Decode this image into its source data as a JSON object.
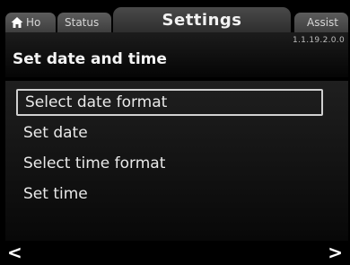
{
  "tabs": {
    "home_label": "Ho",
    "status_label": "Status",
    "active_label": "Settings",
    "assist_label": "Assist"
  },
  "header": {
    "version": "1.1.19.2.0.0",
    "title": "Set date and time"
  },
  "menu": {
    "items": [
      {
        "label": "Select date format",
        "selected": true
      },
      {
        "label": "Set date",
        "selected": false
      },
      {
        "label": "Select time format",
        "selected": false
      },
      {
        "label": "Set time",
        "selected": false
      }
    ]
  },
  "footer": {
    "prev_symbol": "<",
    "next_symbol": ">"
  },
  "icons": {
    "home": "home-icon",
    "prev": "chevron-left-icon",
    "next": "chevron-right-icon"
  },
  "colors": {
    "background": "#000000",
    "tab": "#4a4a4a",
    "text": "#e9e9e9",
    "selection_border": "#d0d0d0"
  }
}
